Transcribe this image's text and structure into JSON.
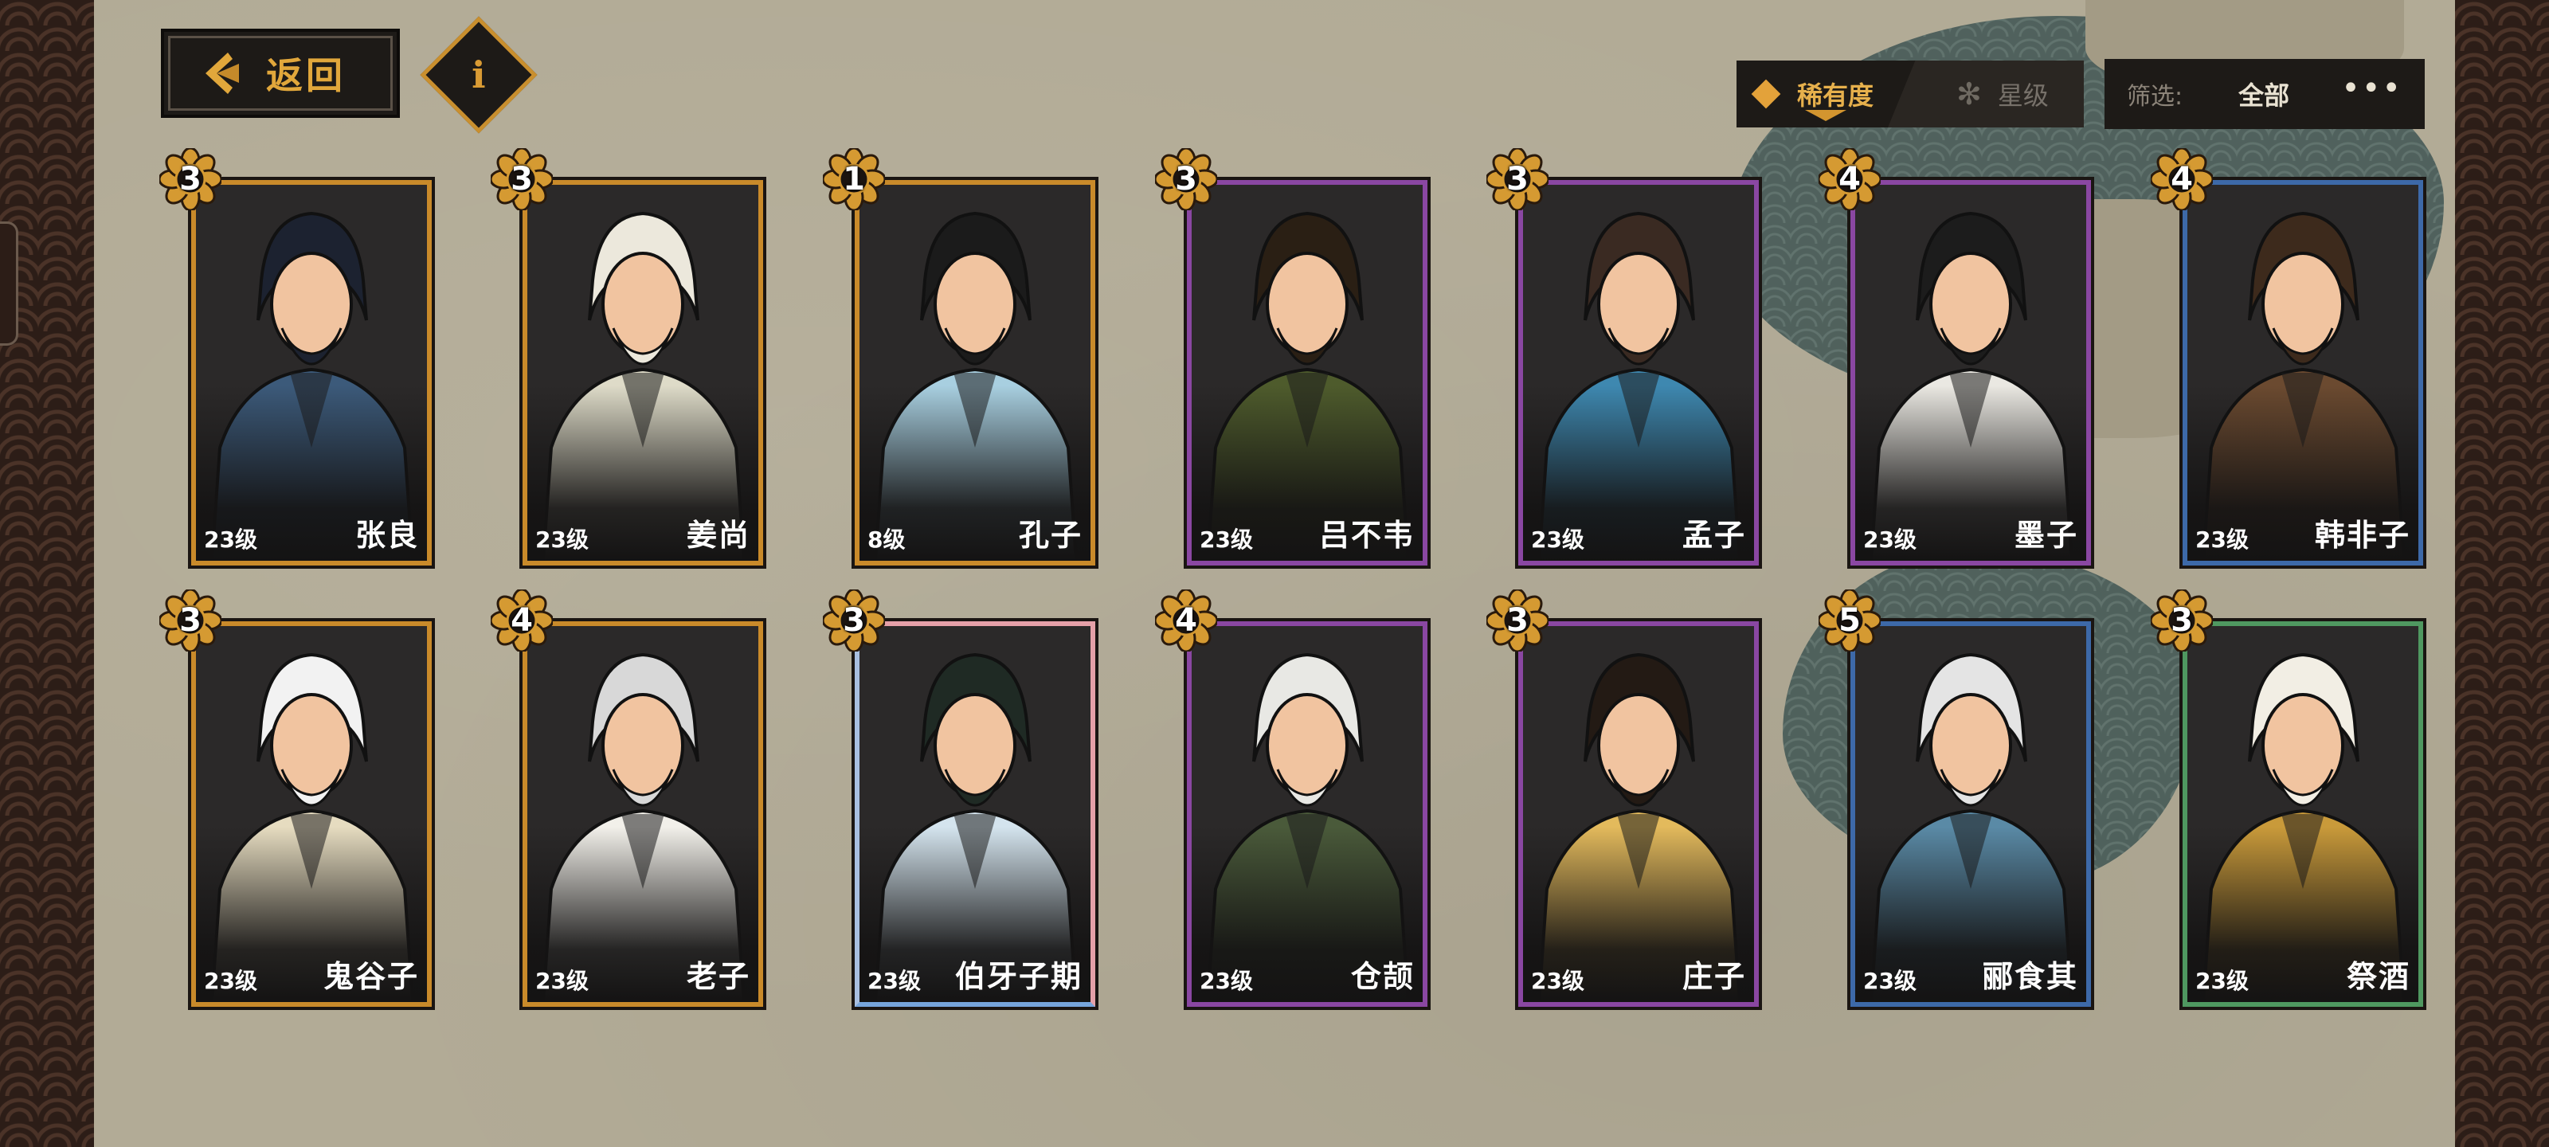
{
  "header": {
    "back_label": "返回",
    "info_symbol": "i",
    "sort_tabs": [
      {
        "label": "稀有度",
        "active": true,
        "icon": "diamond-icon"
      },
      {
        "label": "星级",
        "active": false,
        "icon": "star-flower-icon"
      }
    ],
    "filter": {
      "label": "筛选:",
      "value": "全部",
      "more": "•••"
    }
  },
  "colors": {
    "gold": "#c98a2a",
    "purple": "#8a47a2",
    "blue": "#3d69a8",
    "green": "#4f9860",
    "accent_text": "#e1a73b"
  },
  "cards": [
    {
      "name": "张良",
      "level": "23级",
      "stars": "3",
      "rarity": "gold",
      "robe": "#3c5a7a",
      "hair": "#1c2230"
    },
    {
      "name": "姜尚",
      "level": "23级",
      "stars": "3",
      "rarity": "gold",
      "robe": "#dedbc8",
      "hair": "#ece8dc"
    },
    {
      "name": "孔子",
      "level": "8级",
      "stars": "1",
      "rarity": "gold",
      "robe": "#a8cfe0",
      "hair": "#1b1b1b"
    },
    {
      "name": "吕不韦",
      "level": "23级",
      "stars": "3",
      "rarity": "purple",
      "robe": "#4e5b2c",
      "hair": "#2a1f14"
    },
    {
      "name": "孟子",
      "level": "23级",
      "stars": "3",
      "rarity": "purple",
      "robe": "#3e88b0",
      "hair": "#3a2a22"
    },
    {
      "name": "墨子",
      "level": "23级",
      "stars": "4",
      "rarity": "purple",
      "robe": "#eae8e2",
      "hair": "#1c1c1c"
    },
    {
      "name": "韩非子",
      "level": "23级",
      "stars": "4",
      "rarity": "blue",
      "robe": "#6b4a30",
      "hair": "#3d2a1c"
    },
    {
      "name": "鬼谷子",
      "level": "23级",
      "stars": "3",
      "rarity": "gold",
      "robe": "#e6dcc0",
      "hair": "#f2f2f2"
    },
    {
      "name": "老子",
      "level": "23级",
      "stars": "4",
      "rarity": "gold",
      "robe": "#f2f0ea",
      "hair": "#d8d8d8"
    },
    {
      "name": "伯牙子期",
      "level": "23级",
      "stars": "3",
      "rarity": "rainbow",
      "robe": "#d4e4ee",
      "hair": "#1f2a24"
    },
    {
      "name": "仓颉",
      "level": "23级",
      "stars": "4",
      "rarity": "purple",
      "robe": "#4a5a3a",
      "hair": "#e8e8e4"
    },
    {
      "name": "庄子",
      "level": "23级",
      "stars": "3",
      "rarity": "purple",
      "robe": "#e3ba5c",
      "hair": "#231a14"
    },
    {
      "name": "郦食其",
      "level": "23级",
      "stars": "5",
      "rarity": "blue",
      "robe": "#5a8aa6",
      "hair": "#e4e4e4"
    },
    {
      "name": "祭酒",
      "level": "23级",
      "stars": "3",
      "rarity": "green",
      "robe": "#c99a3a",
      "hair": "#f2eee4"
    }
  ]
}
